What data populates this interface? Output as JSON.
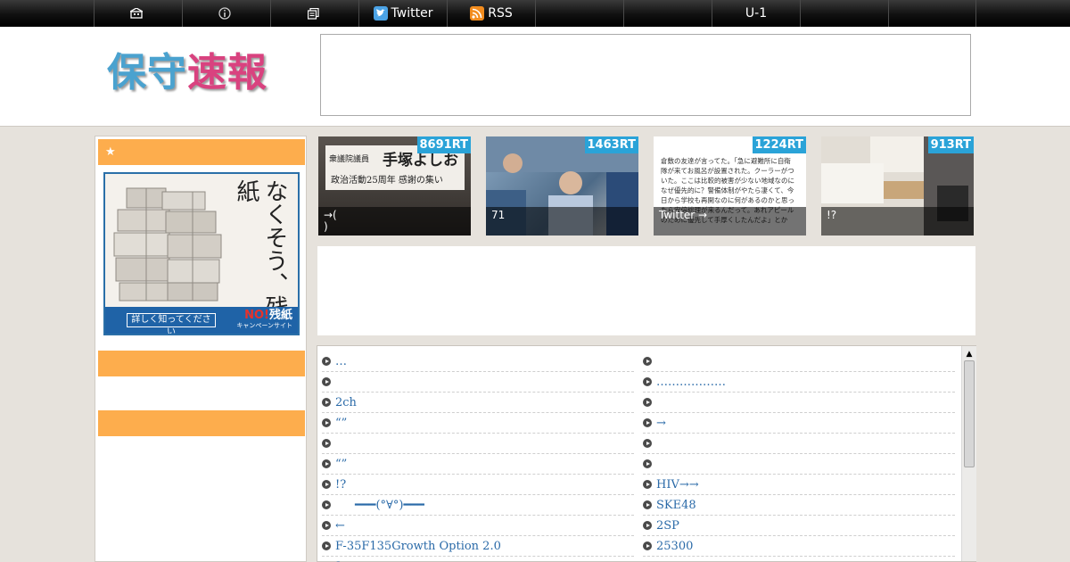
{
  "nav": {
    "items": [
      {
        "icon": "home-icon",
        "label": ""
      },
      {
        "icon": "info-icon",
        "label": ""
      },
      {
        "icon": "archive-icon",
        "label": ""
      },
      {
        "icon": "twitter-icon",
        "label": "Twitter"
      },
      {
        "icon": "rss-icon",
        "label": "RSS"
      },
      {
        "icon": "",
        "label": ""
      },
      {
        "icon": "",
        "label": ""
      },
      {
        "icon": "",
        "label": "U-1"
      },
      {
        "icon": "",
        "label": ""
      },
      {
        "icon": "",
        "label": ""
      }
    ]
  },
  "header": {
    "logo_part1": "保守",
    "logo_part2": "速報"
  },
  "sidebar": {
    "section1_title": "★",
    "section2_title": "",
    "section3_title": "",
    "banner": {
      "headline": "なくそう、残紙",
      "button": "詳しく知ってください",
      "no": "NO!",
      "brand": "残紙",
      "sub": "キャンペーンサイト"
    }
  },
  "rankings": [
    {
      "rt": "8691RT",
      "caption": "→(\n)",
      "image_text_small": "衆議院議員",
      "image_text_name": "手塚よしお",
      "image_text_sub": "政治活動25周年 感謝の集い"
    },
    {
      "rt": "1463RT",
      "caption": "71"
    },
    {
      "rt": "1224RT",
      "caption": "Twitter →",
      "image_text": "倉敷の友達が言ってた。「急に避難所に自衛隊が来てお風呂が設置された。クーラーがついた。ここは比較的被害が少ない地域なのになぜ優先的に？警備体制がやたら凄くて、今日から学校も再開なのに何があるのかと思ったら安倍総理が来るんだって。あれアピールのために優先して手厚くしたんだよ」とか"
    },
    {
      "rt": "913RT",
      "caption": "!?"
    }
  ],
  "links": {
    "left": [
      "…",
      "",
      "2ch",
      "“”",
      "",
      "“”",
      " !?",
      "━━━(°∀°)━━━",
      "←",
      "F-35F135Growth Option 2.0",
      "?"
    ],
    "right": [
      "",
      "………………",
      "",
      "→",
      "",
      "",
      "HIV→→",
      "SKE48",
      "2SP",
      "25300",
      ""
    ]
  },
  "colors": {
    "accent_orange": "#fdad4d",
    "rt_blue": "#2aa3d8",
    "link_blue": "#2a6aa8",
    "logo_blue": "#4aa2cf",
    "logo_pink": "#d9427f"
  }
}
